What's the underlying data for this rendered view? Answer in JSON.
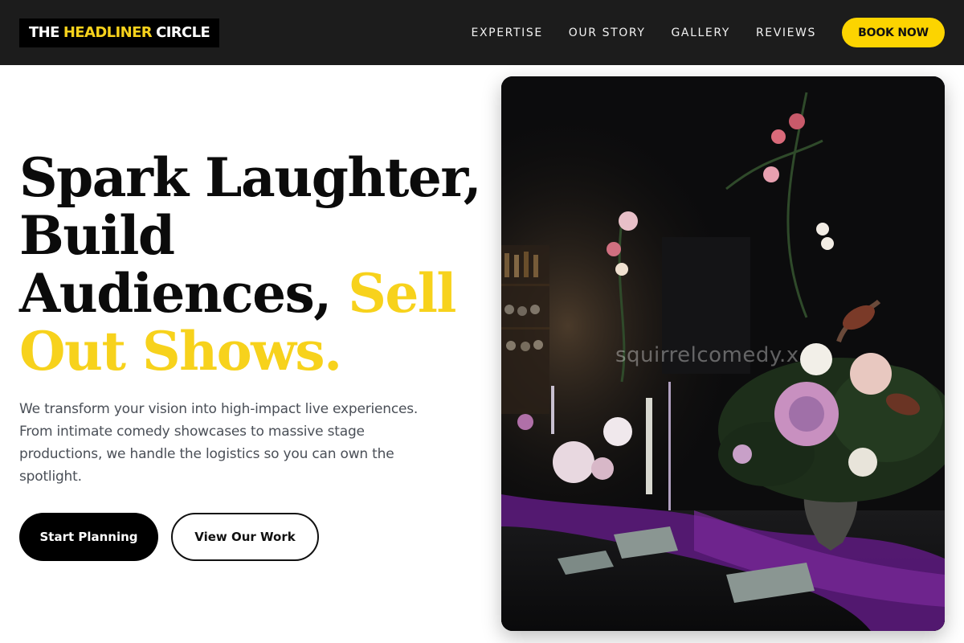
{
  "brand": {
    "prefix": "THE",
    "accent": "HEADLINER",
    "suffix": "CIRCLE"
  },
  "nav": {
    "items": [
      "EXPERTISE",
      "OUR STORY",
      "GALLERY",
      "REVIEWS"
    ],
    "cta": "BOOK NOW"
  },
  "hero": {
    "title_line1": "Spark Laughter,",
    "title_line2": "Build",
    "title_line3": "Audiences,",
    "title_highlight_a": "Sell",
    "title_highlight_b": "Out Shows.",
    "subtitle": "We transform your vision into high-impact live experiences. From intimate comedy showcases to massive stage productions, we handle the logistics so you can own the spotlight.",
    "primary_button": "Start Planning",
    "secondary_button": "View Our Work",
    "image_watermark": "squirrelcomedy.x"
  },
  "colors": {
    "accent": "#fcd400",
    "header_bg": "#1c1c1c",
    "text_dark": "#0b0b0b",
    "text_muted": "#4a4f57"
  },
  "icons": {
    "hero_image": "dinner-table-flowers-photo"
  }
}
